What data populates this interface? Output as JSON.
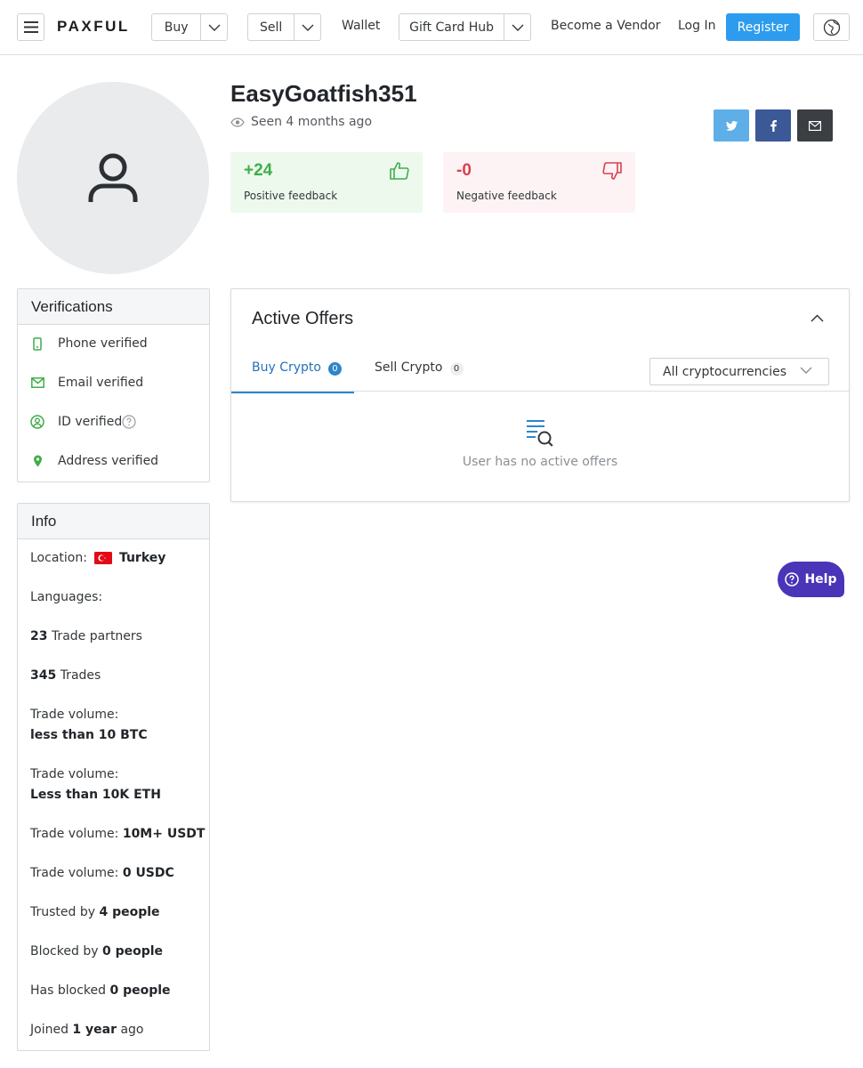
{
  "header": {
    "logo": "PAXFUL",
    "buy_label": "Buy",
    "sell_label": "Sell",
    "wallet_label": "Wallet",
    "gift_card_label": "Gift Card Hub",
    "vendor_label": "Become a Vendor",
    "login_label": "Log In",
    "register_label": "Register"
  },
  "profile": {
    "username": "EasyGoatfish351",
    "seen": "Seen 4 months ago",
    "positive": {
      "value": "+24",
      "label": "Positive feedback"
    },
    "negative": {
      "value": "-0",
      "label": "Negative feedback"
    },
    "share_colors": {
      "twitter": "#5eaee8",
      "facebook": "#3b5897",
      "email": "#3b3f43"
    }
  },
  "verifications": {
    "title": "Verifications",
    "items": [
      {
        "label": "Phone verified",
        "icon": "phone-icon"
      },
      {
        "label": "Email verified",
        "icon": "email-icon"
      },
      {
        "label": "ID verified",
        "icon": "id-icon"
      },
      {
        "label": "Address verified",
        "icon": "location-pin-icon"
      }
    ]
  },
  "info": {
    "title": "Info",
    "location_label": "Location:",
    "location_value": "Turkey",
    "languages_label": "Languages:",
    "trade_partners_count": "23",
    "trade_partners_label": "Trade partners",
    "trades_count": "345",
    "trades_label": "Trades",
    "btc_label": "Trade volume:",
    "btc_value": "less than 10 BTC",
    "eth_label": "Trade volume:",
    "eth_value": "Less than 10K ETH",
    "usdt_label": "Trade volume:",
    "usdt_value": "10M+ USDT",
    "usdc_label": "Trade volume:",
    "usdc_value": "0 USDC",
    "trusted_prefix": "Trusted by",
    "trusted_value": "4 people",
    "blocked_prefix": "Blocked by",
    "blocked_value": "0 people",
    "has_blocked_prefix": "Has blocked",
    "has_blocked_value": "0 people",
    "joined_prefix": "Joined",
    "joined_value": "1 year",
    "joined_suffix": "ago"
  },
  "offers": {
    "title": "Active Offers",
    "tabs": [
      {
        "label": "Buy Crypto",
        "count": "0"
      },
      {
        "label": "Sell Crypto",
        "count": "0"
      }
    ],
    "filter_value": "All cryptocurrencies",
    "empty_text": "User has no active offers"
  },
  "help": {
    "label": "Help",
    "color": "#4a34b8"
  },
  "colors": {
    "accent": "#2d9cee",
    "positive": "#3fae4a",
    "negative": "#d9414f",
    "verified": "#3fae4a"
  }
}
